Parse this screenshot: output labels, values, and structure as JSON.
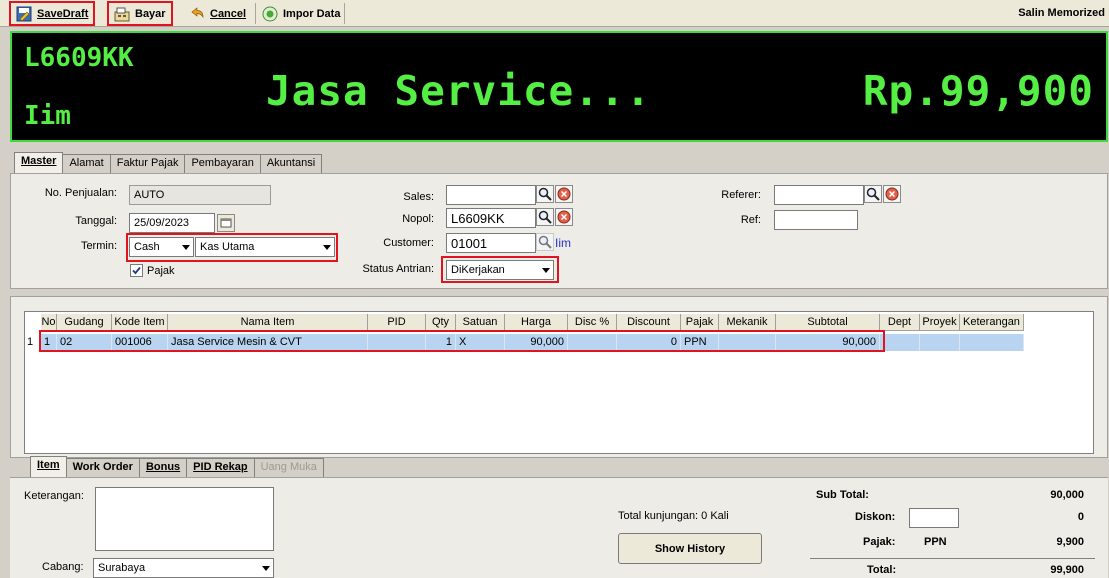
{
  "toolbar": {
    "save_draft": "SaveDraft",
    "bayar": "Bayar",
    "cancel": "Cancel",
    "impor_data": "Impor Data",
    "salin_memorized": "Salin Memorized"
  },
  "display": {
    "plate": "L6609KK",
    "customer_name": "Iim",
    "item": "Jasa Service...",
    "total": "Rp.99,900"
  },
  "main_tabs": [
    "Master",
    "Alamat",
    "Faktur Pajak",
    "Pembayaran",
    "Akuntansi"
  ],
  "form": {
    "no_penjualan_label": "No. Penjualan:",
    "no_penjualan": "AUTO",
    "tanggal_label": "Tanggal:",
    "tanggal": "25/09/2023",
    "termin_label": "Termin:",
    "termin": "Cash",
    "kas": "Kas Utama",
    "pajak_label": "Pajak",
    "pajak_checked": true,
    "sales_label": "Sales:",
    "sales": "",
    "nopol_label": "Nopol:",
    "nopol": "L6609KK",
    "customer_label": "Customer:",
    "customer": "01001",
    "customer_name": "Iim",
    "status_antrian_label": "Status Antrian:",
    "status_antrian": "DiKerjakan",
    "referer_label": "Referer:",
    "referer": "",
    "ref_label": "Ref:",
    "ref": ""
  },
  "grid": {
    "headers": [
      "No",
      "Gudang",
      "Kode Item",
      "Nama Item",
      "PID",
      "Qty",
      "Satuan",
      "Harga",
      "Disc %",
      "Discount",
      "Pajak",
      "Mekanik",
      "Subtotal",
      "Dept",
      "Proyek",
      "Keterangan"
    ],
    "rows": [
      {
        "row_num": "1",
        "no": "1",
        "gudang": "02",
        "kode": "001006",
        "nama": "Jasa Service Mesin & CVT",
        "pid": "",
        "qty": "1",
        "satuan": "X",
        "harga": "90,000",
        "disc_pct": "",
        "discount": "0",
        "pajak": "PPN",
        "mekanik": "",
        "subtotal": "90,000",
        "dept": "",
        "proyek": "",
        "keterangan": ""
      }
    ]
  },
  "bottom_tabs": [
    "Item",
    "Work Order",
    "Bonus",
    "PID Rekap",
    "Uang Muka"
  ],
  "bottom": {
    "keterangan_label": "Keterangan:",
    "keterangan": "",
    "cabang_label": "Cabang:",
    "cabang": "Surabaya",
    "total_kunjungan": "Total kunjungan:  0 Kali",
    "show_history": "Show History"
  },
  "totals": {
    "sub_total_label": "Sub Total:",
    "sub_total": "90,000",
    "diskon_label": "Diskon:",
    "diskon_input": "",
    "diskon": "0",
    "pajak_label": "Pajak:",
    "pajak_type": "PPN",
    "pajak": "9,900",
    "total_label": "Total:",
    "total": "99,900"
  }
}
